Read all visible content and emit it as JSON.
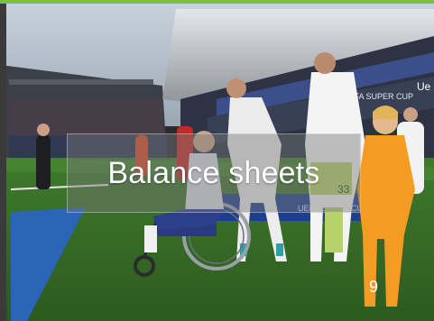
{
  "slide": {
    "title": "Balance sheets",
    "number": "9"
  },
  "colors": {
    "accent": "#7fbf3f",
    "title_text": "#ffffff",
    "title_box": "rgba(120,120,120,0.45)"
  },
  "photo": {
    "banner_text_1": "UEFA SUPER CUP",
    "banner_text_2": "UEFA SUPER CUP",
    "banner_text_3": "Ue"
  }
}
